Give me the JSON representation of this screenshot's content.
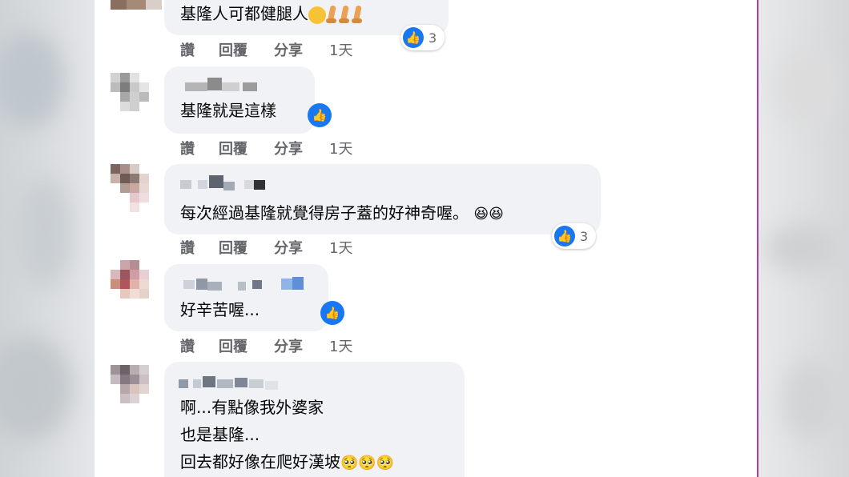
{
  "comments": [
    {
      "text": "基隆人可都健腿人",
      "actions": [
        "讚",
        "回覆",
        "分享",
        "1天"
      ],
      "reaction_count": "3",
      "reaction_icon": "like-icon"
    },
    {
      "text": "基隆就是這樣",
      "actions": [
        "讚",
        "回覆",
        "分享",
        "1天"
      ],
      "reaction_icon": "like-icon"
    },
    {
      "text": "每次經過基隆就覺得房子蓋的好神奇喔。",
      "actions": [
        "讚",
        "回覆",
        "分享",
        "1天"
      ],
      "reaction_count": "3",
      "reaction_icon": "like-icon"
    },
    {
      "text": "好辛苦喔...",
      "actions": [
        "讚",
        "回覆",
        "分享",
        "1天"
      ],
      "reaction_icon": "like-icon"
    },
    {
      "lines": [
        "啊...有點像我外婆家",
        "也是基隆...",
        "回去都好像在爬好漢坡"
      ]
    }
  ],
  "colors": {
    "bubble": "#f0f2f5",
    "like_blue": "#1877f2",
    "action_gray": "#65676b",
    "text": "#050505"
  }
}
